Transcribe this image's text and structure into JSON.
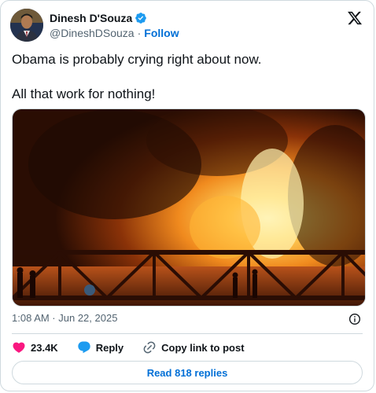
{
  "author": {
    "name": "Dinesh D'Souza",
    "handle": "@DineshDSouza",
    "separator": "·",
    "follow_label": "Follow"
  },
  "tweet": {
    "line1": "Obama is probably crying right about now.",
    "line2": "All that work for nothing!"
  },
  "meta": {
    "timestamp": "1:08 AM · Jun 22, 2025"
  },
  "actions": {
    "likes": "23.4K",
    "reply_label": "Reply",
    "copy_label": "Copy link to post"
  },
  "read_replies_label": "Read 818 replies",
  "colors": {
    "brand_blue": "#006fd6",
    "like_red": "#f91880",
    "reply_blue": "#1d9bf0",
    "text_secondary": "#536471",
    "border": "#cfd9de"
  },
  "icons": {
    "logo": "x-logo-icon",
    "verified": "verified-badge-icon",
    "info": "info-icon",
    "like": "heart-icon",
    "reply": "speech-bubble-icon",
    "copy": "link-icon"
  }
}
